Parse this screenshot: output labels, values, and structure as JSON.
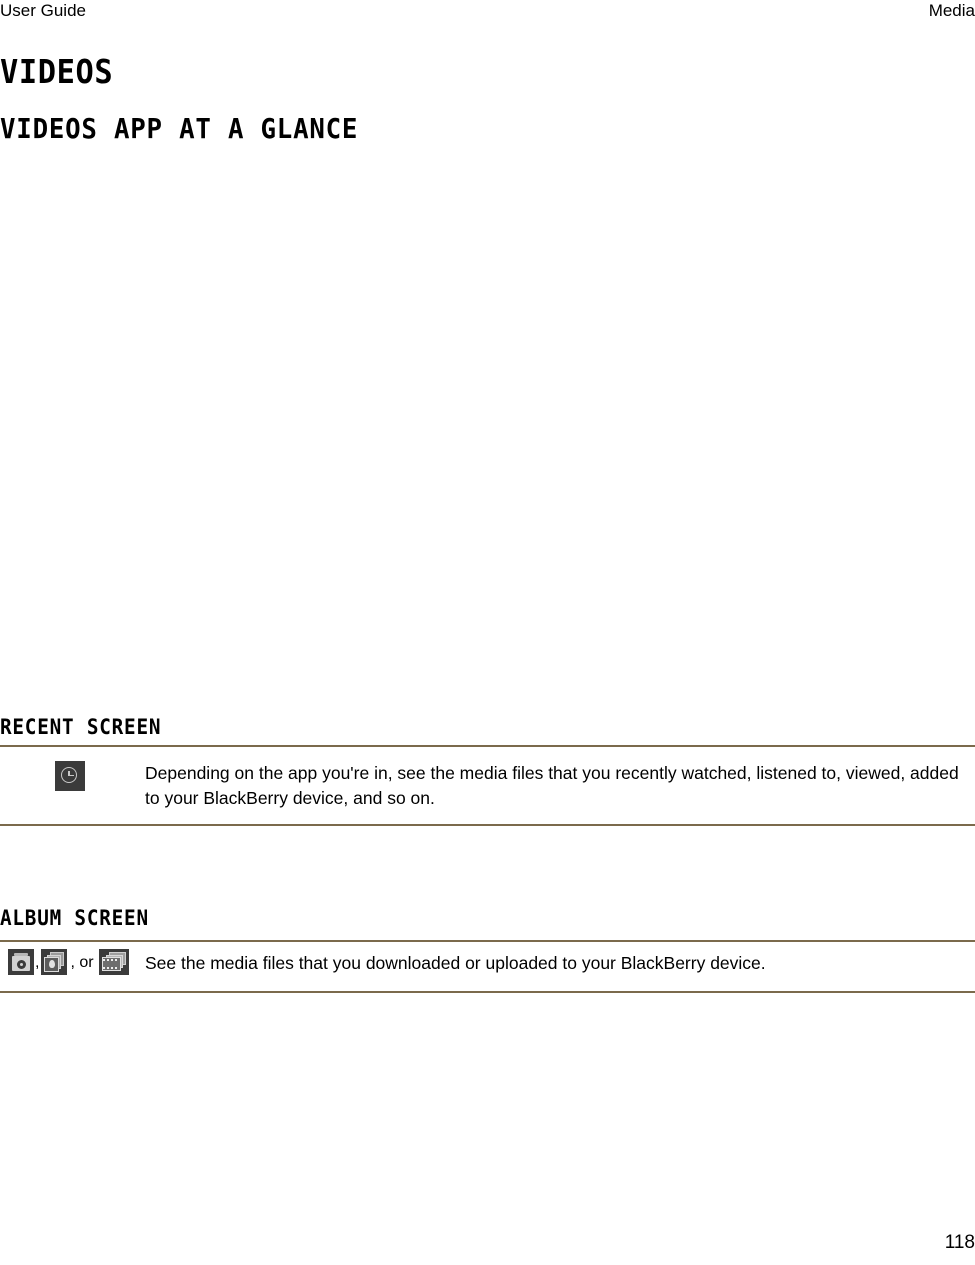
{
  "header": {
    "left_label": "User Guide",
    "right_label": "Media"
  },
  "document": {
    "title": "Videos",
    "section_title": "Videos app at a glance"
  },
  "sections": [
    {
      "heading": "Recent screen",
      "rows": [
        {
          "icons": [
            "clock-icon"
          ],
          "description": "Depending on the app you're in, see the media files that you recently watched, listened to, viewed, added to your BlackBerry device, and so on."
        }
      ]
    },
    {
      "heading": "Album screen",
      "rows": [
        {
          "icons": [
            "music-album-icon",
            "pictures-icon",
            "videos-film-icon"
          ],
          "separator_1": ",",
          "separator_2": ", or",
          "description": "See the media files that you downloaded or uploaded to your BlackBerry device."
        }
      ]
    }
  ],
  "footer": {
    "page_number": "118"
  },
  "colors": {
    "rule": "#7b6a4c",
    "icon_background": "#3b3b3b",
    "text": "#000000",
    "page_background": "#ffffff"
  }
}
